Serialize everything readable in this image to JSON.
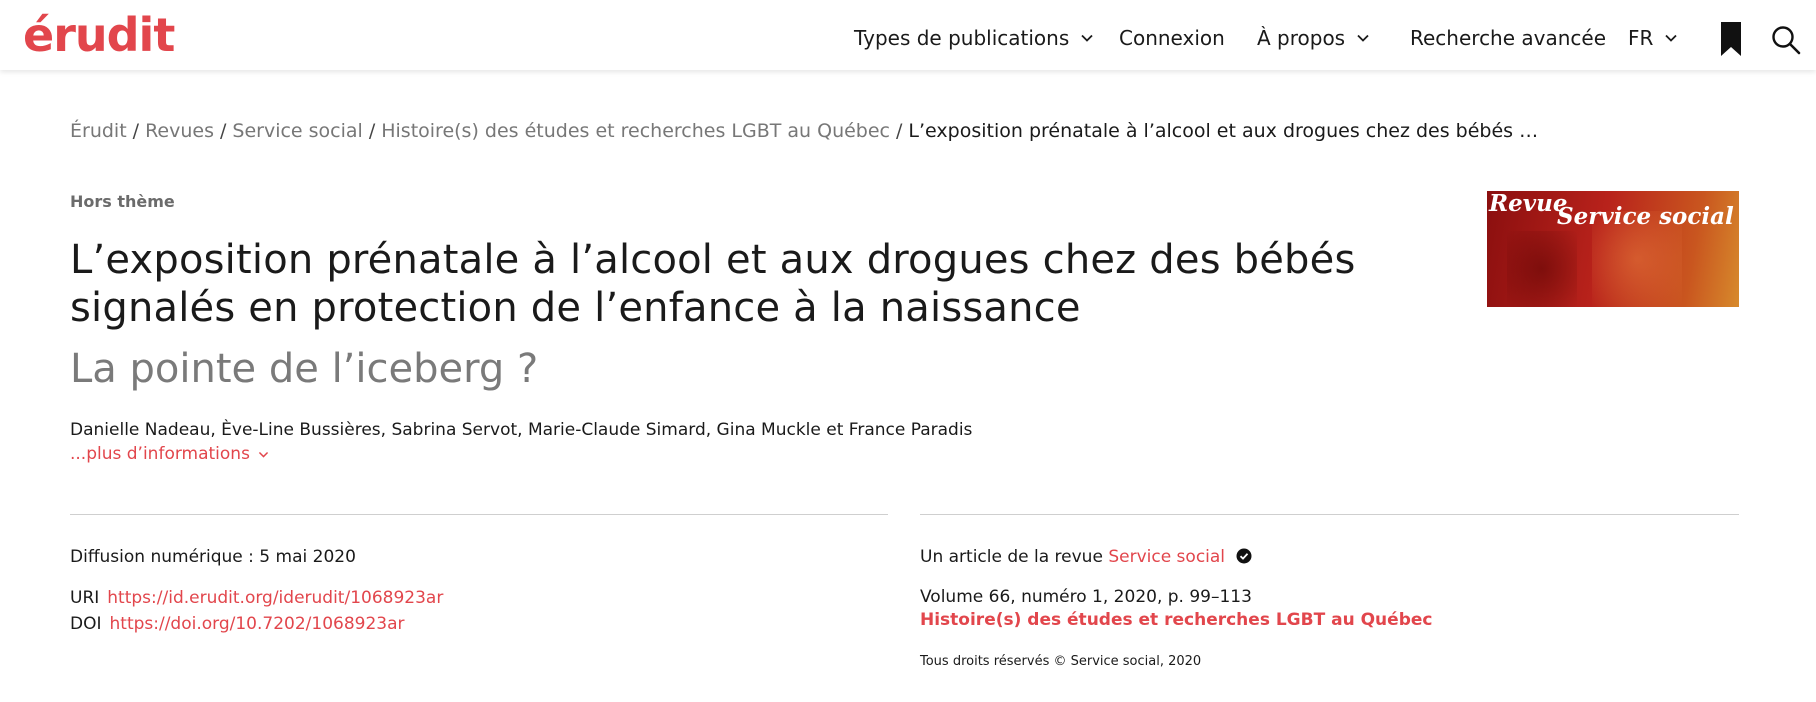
{
  "header": {
    "logo": "érudit",
    "nav": {
      "types": "Types de publications",
      "login": "Connexion",
      "about": "À propos",
      "advanced_search": "Recherche avancée",
      "language": "FR"
    },
    "icons": {
      "bookmark": "bookmark-icon",
      "search": "search-icon"
    }
  },
  "breadcrumb": {
    "items": [
      "Érudit",
      "Revues",
      "Service social",
      "Histoire(s) des études et recherches LGBT au Québec"
    ],
    "current": "L’exposition prénatale à l’alcool et aux drogues chez des bébés …",
    "separator": "/"
  },
  "article": {
    "section": "Hors thème",
    "title_line1": "L’exposition prénatale à l’alcool et aux drogues chez des bébés",
    "title_line2": "signalés en protection de l’enfance à la naissance",
    "subtitle": "La pointe de l’iceberg ?",
    "authors": "Danielle Nadeau, Ève-Line Bussières, Sabrina Servot, Marie-Claude Simard, Gina Muckle et France Paradis",
    "more_info": "...plus d’informations"
  },
  "cover": {
    "word1": "Revue",
    "word2": "Service social"
  },
  "info_left": {
    "diffusion": "Diffusion numérique : 5 mai 2020",
    "uri_label": "URI",
    "uri_value": "https://id.erudit.org/iderudit/1068923ar",
    "doi_label": "DOI",
    "doi_value": "https://doi.org/10.7202/1068923ar"
  },
  "info_right": {
    "article_of": "Un article de la revue",
    "journal": "Service social",
    "volume": "Volume 66, numéro 1, 2020, p. 99–113",
    "issue": "Histoire(s) des études et recherches LGBT au Québec",
    "rights": "Tous droits réservés © Service social, 2020"
  },
  "colors": {
    "accent": "#e2464c",
    "text": "#1a1a1a",
    "muted": "#777777"
  }
}
